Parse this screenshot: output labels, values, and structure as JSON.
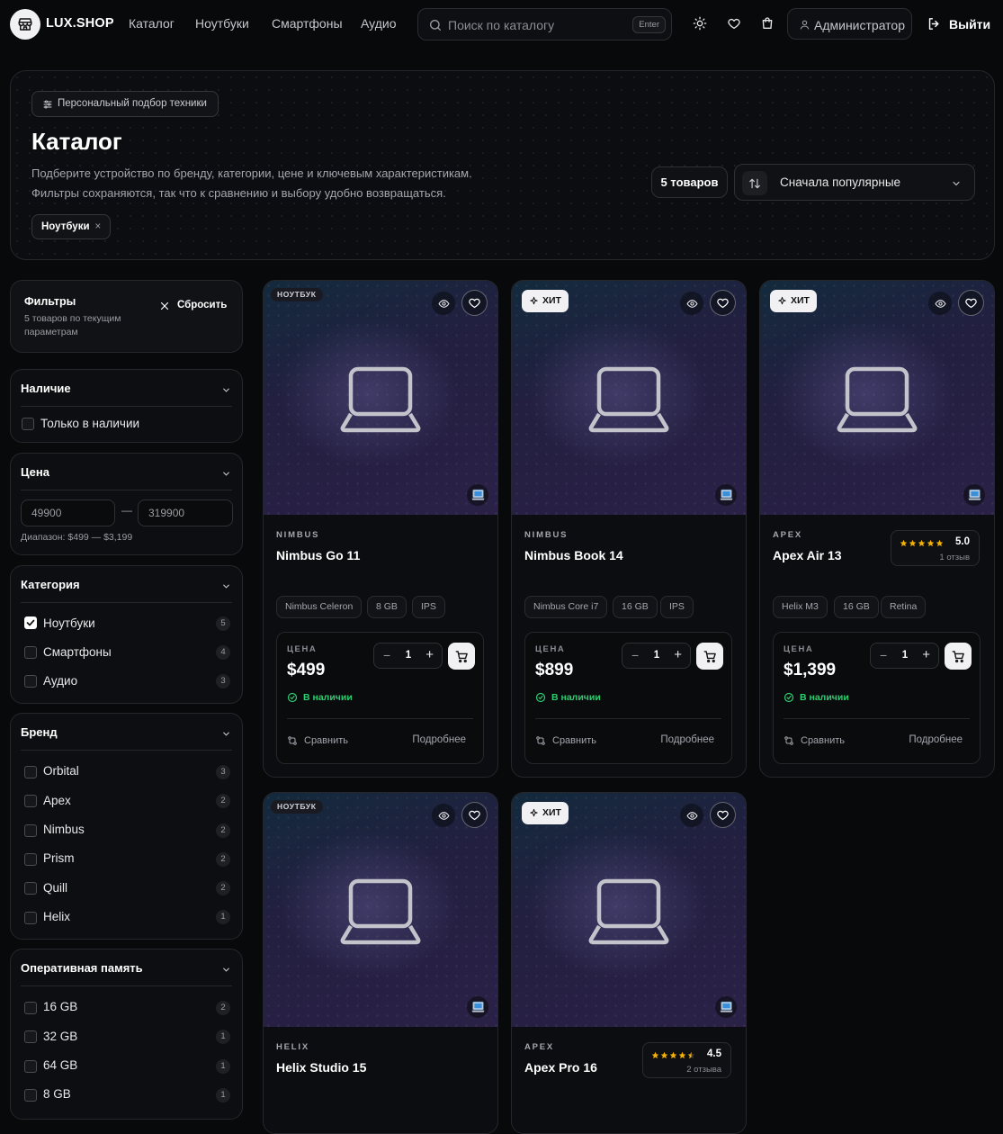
{
  "header": {
    "brand": "LUX.SHOP",
    "nav": [
      "Каталог",
      "Ноутбуки",
      "Смартфоны",
      "Аудио"
    ],
    "search_placeholder": "Поиск по каталогу",
    "search_hint": "Enter",
    "icons": [
      "sun-icon",
      "heart-icon",
      "bag-icon"
    ],
    "user": "Администратор",
    "logout": "Выйти"
  },
  "hero": {
    "tag": "Персональный подбор техники",
    "title": "Каталог",
    "desc_line1": "Подберите устройство по бренду, категории, цене и ключевым характеристикам.",
    "desc_line2": "Фильтры сохраняются, так что к сравнению и выбору удобно возвращаться.",
    "active_chip": "Ноутбуки",
    "count": "5 товаров",
    "sort": "Сначала популярные"
  },
  "filters": {
    "title": "Фильтры",
    "subtitle_line1": "5 товаров по текущим",
    "subtitle_line2": "параметрам",
    "reset": "Сбросить",
    "availability": {
      "title": "Наличие",
      "option": "Только в наличии"
    },
    "price": {
      "title": "Цена",
      "min": "49900",
      "max": "319900",
      "dash": "—",
      "range": "Диапазон: $499 — $3,199"
    },
    "category": {
      "title": "Категория",
      "options": [
        {
          "label": "Ноутбуки",
          "count": "5",
          "checked": true
        },
        {
          "label": "Смартфоны",
          "count": "4",
          "checked": false
        },
        {
          "label": "Аудио",
          "count": "3",
          "checked": false
        }
      ]
    },
    "brand": {
      "title": "Бренд",
      "options": [
        {
          "label": "Orbital",
          "count": "3"
        },
        {
          "label": "Apex",
          "count": "2"
        },
        {
          "label": "Nimbus",
          "count": "2"
        },
        {
          "label": "Prism",
          "count": "2"
        },
        {
          "label": "Quill",
          "count": "2"
        },
        {
          "label": "Helix",
          "count": "1"
        }
      ]
    },
    "ram": {
      "title": "Оперативная память",
      "options": [
        {
          "label": "16 GB",
          "count": "2"
        },
        {
          "label": "32 GB",
          "count": "1"
        },
        {
          "label": "64 GB",
          "count": "1"
        },
        {
          "label": "8 GB",
          "count": "1"
        }
      ]
    }
  },
  "product_ui": {
    "price_label": "ЦЕНА",
    "in_stock": "В наличии",
    "compare": "Сравнить",
    "details": "Подробнее",
    "qty": "1",
    "minus": "−",
    "plus": "+",
    "tag_laptop": "НОУТБУК",
    "tag_hit": "ХИТ",
    "close_x": "×"
  },
  "products": [
    {
      "tag": "laptop",
      "brand": "NIMBUS",
      "name": "Nimbus Go 11",
      "specs": [
        "Nimbus Celeron",
        "8 GB",
        "IPS"
      ],
      "price": "$499"
    },
    {
      "tag": "hit",
      "brand": "NIMBUS",
      "name": "Nimbus Book 14",
      "specs": [
        "Nimbus Core i7",
        "16 GB",
        "IPS"
      ],
      "price": "$899"
    },
    {
      "tag": "hit",
      "brand": "APEX",
      "name": "Apex Air 13",
      "specs": [
        "Helix M3",
        "16 GB",
        "Retina"
      ],
      "price": "$1,399",
      "rating": "5.0",
      "reviews": "1 отзыв",
      "stars": 5
    },
    {
      "tag": "laptop",
      "brand": "HELIX",
      "name": "Helix Studio 15"
    },
    {
      "tag": "hit",
      "brand": "APEX",
      "name": "Apex Pro 16",
      "rating": "4.5",
      "reviews": "2 отзыва",
      "stars": 4.5
    }
  ],
  "colors": {
    "accent_green": "#2ecc71",
    "star": "#f5b301",
    "bg": "#08090b"
  }
}
